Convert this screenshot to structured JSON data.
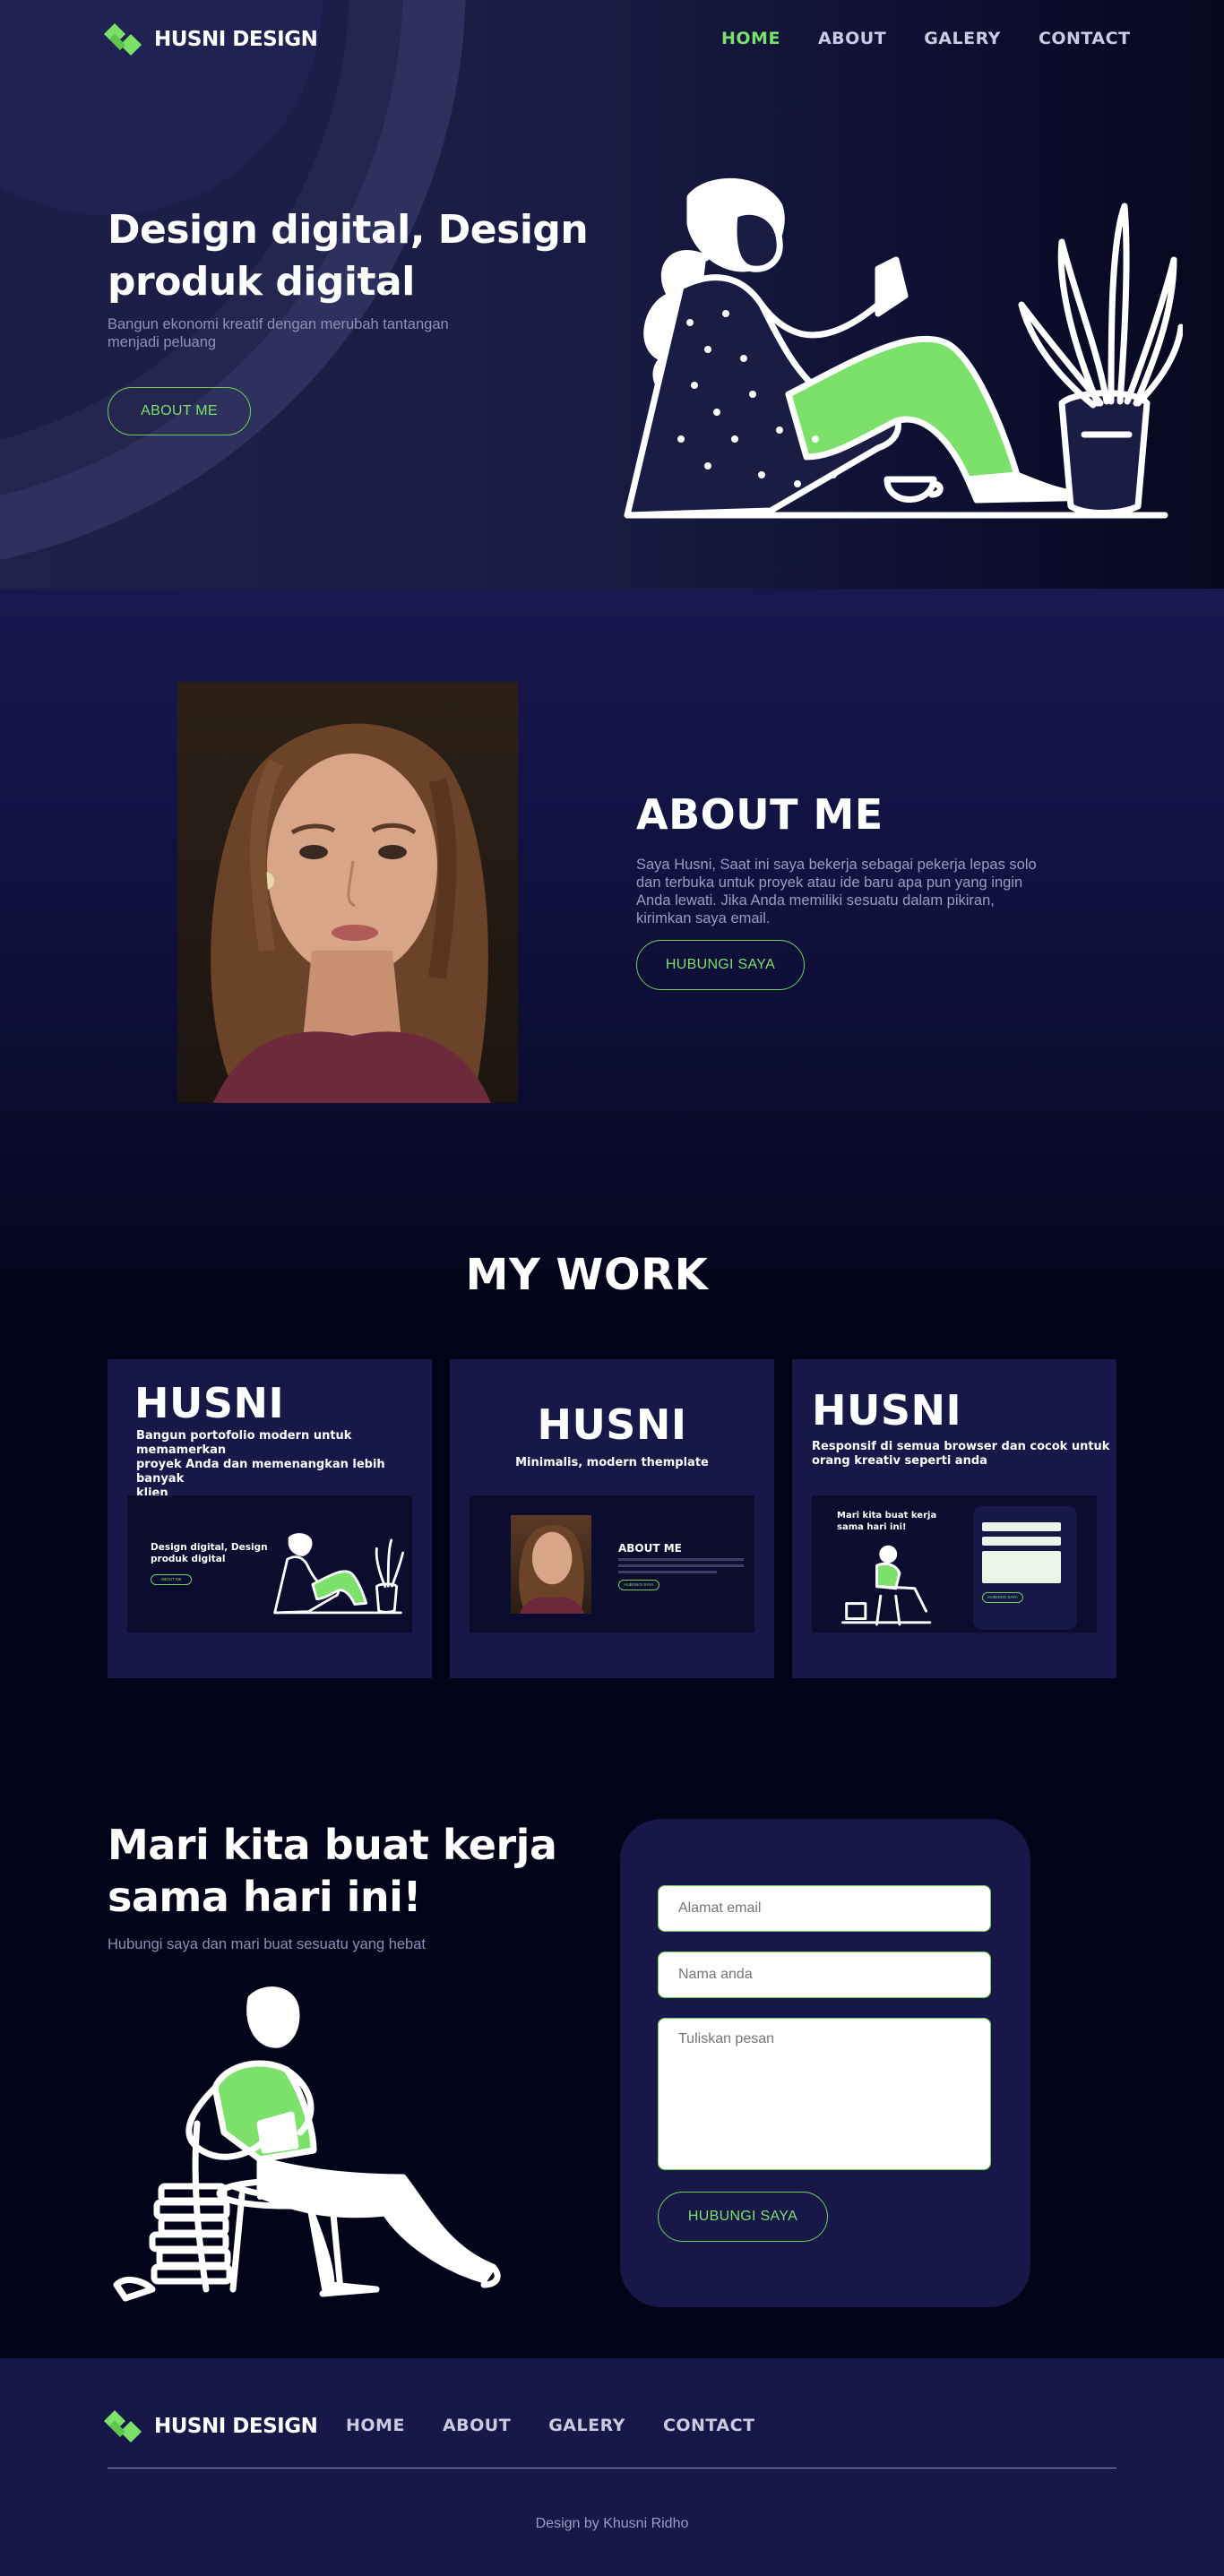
{
  "brand": {
    "name": "HUSNI DESIGN",
    "logo_icon": "diamond-logo-icon",
    "accent": "#7be16a"
  },
  "nav": [
    {
      "label": "HOME",
      "active": true
    },
    {
      "label": "ABOUT",
      "active": false
    },
    {
      "label": "GALERY",
      "active": false
    },
    {
      "label": "CONTACT",
      "active": false
    }
  ],
  "hero": {
    "title_line1": "Design digital, Design",
    "title_line2": "produk digital",
    "subtitle_line1": "Bangun ekonomi kreatif dengan merubah tantangan",
    "subtitle_line2": "menjadi peluang",
    "button": "ABOUT ME"
  },
  "about": {
    "title": "ABOUT ME",
    "lines": [
      "Saya Husni, Saat ini saya bekerja sebagai pekerja lepas solo",
      "dan terbuka untuk proyek atau ide baru apa pun yang ingin",
      "Anda lewati. Jika Anda memiliki sesuatu dalam pikiran,",
      "kirimkan saya email."
    ],
    "button": "HUBUNGI SAYA"
  },
  "work": {
    "title": "MY WORK",
    "cards": [
      {
        "title": "HUSNI",
        "desc": [
          "Bangun portofolio modern untuk memamerkan",
          "proyek Anda dan memenangkan lebih banyak",
          "klien"
        ],
        "thumb_title": [
          "Design digital, Design",
          "produk digital"
        ],
        "thumb_button": "ABOUT ME"
      },
      {
        "title": "HUSNI",
        "desc": [
          "Minimalis, modern themplate"
        ],
        "thumb_title": [
          "ABOUT ME"
        ],
        "thumb_button": "HUBUNGI SAYA"
      },
      {
        "title": "HUSNI",
        "desc": [
          "Responsif di semua browser dan cocok untuk",
          "orang kreativ seperti anda"
        ],
        "thumb_title": [
          "Mari kita buat kerja",
          "sama hari ini!"
        ],
        "thumb_button": "HUBUNGI SAYA"
      }
    ]
  },
  "contact": {
    "title_line1": "Mari kita buat kerja",
    "title_line2": "sama hari ini!",
    "subtitle": "Hubungi saya dan mari buat sesuatu yang hebat",
    "email_placeholder": "Alamat email",
    "name_placeholder": "Nama anda",
    "message_placeholder": "Tuliskan pesan",
    "button": "HUBUNGI SAYA"
  },
  "footer": {
    "nav": [
      "HOME",
      "ABOUT",
      "GALERY",
      "CONTACT"
    ],
    "credit": "Design by Khusni Ridho"
  }
}
